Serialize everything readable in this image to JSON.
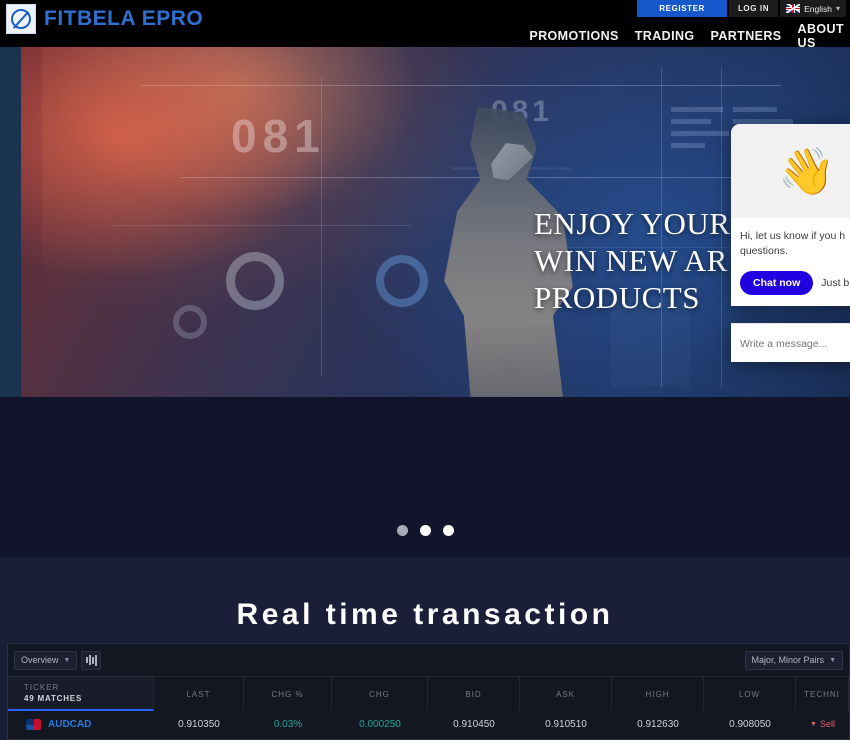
{
  "header": {
    "brand": "FITBELA EPRO",
    "logo_icon": "circle-slash-logo-icon",
    "register_label": "REGISTER",
    "login_label": "LOG IN",
    "language_label": "English",
    "language_flag_icon": "uk-flag-icon",
    "language_caret_icon": "chevron-down-icon",
    "nav": [
      {
        "label": "PROMOTIONS"
      },
      {
        "label": "TRADING"
      },
      {
        "label": "PARTNERS"
      },
      {
        "label": "ABOUT US"
      }
    ],
    "colors": {
      "register_bg": "#1658cc",
      "brand_text": "#2f6fd0",
      "bar_bg": "#000000"
    }
  },
  "hero": {
    "line1": "ENJOY YOUR T",
    "line2": "WIN NEW AR",
    "line3": "PRODUCTS",
    "overlay_numbers": {
      "left": "081",
      "right": "081"
    }
  },
  "chat": {
    "emoji_icon": "waving-hand-icon",
    "emoji": "👋",
    "message": "Hi, let us know if you h",
    "message_line2": "questions.",
    "chat_now_label": "Chat now",
    "just_browsing_label": "Just br",
    "input_placeholder": "Write a message...",
    "colors": {
      "chat_now_bg": "#2000e0",
      "card_bg": "#ffffff",
      "hero_bg": "#f1f1f1"
    }
  },
  "carousel": {
    "dots": [
      {
        "active": false
      },
      {
        "active": true
      },
      {
        "active": true
      }
    ]
  },
  "section": {
    "title": "Real time transaction"
  },
  "widget": {
    "view_select": "Overview",
    "view_caret_icon": "chevron-down-icon",
    "grid_icon": "bar-chart-icon",
    "pairs_select": "Major, Minor Pairs",
    "pairs_caret_icon": "chevron-down-icon",
    "columns": [
      {
        "key": "ticker",
        "label": "TICKER",
        "sub": "49 MATCHES"
      },
      {
        "key": "last",
        "label": "LAST"
      },
      {
        "key": "chgp",
        "label": "CHG %"
      },
      {
        "key": "chg",
        "label": "CHG"
      },
      {
        "key": "bid",
        "label": "BID"
      },
      {
        "key": "ask",
        "label": "ASK"
      },
      {
        "key": "high",
        "label": "HIGH"
      },
      {
        "key": "low",
        "label": "LOW"
      },
      {
        "key": "tech",
        "label": "TECHNI"
      }
    ],
    "rows": [
      {
        "symbol": "AUDCAD",
        "flag_icon": "audcad-flag-icon",
        "last": "0.910350",
        "chg_percent": "0.03%",
        "chg": "0.000250",
        "bid": "0.910450",
        "ask": "0.910510",
        "high": "0.912630",
        "low": "0.908050",
        "technical": "Sell",
        "technical_arrow": "▼"
      }
    ],
    "colors": {
      "positive": "#26a69a",
      "negative": "#f05c6e",
      "accent": "#2962ff",
      "bg": "#131722"
    }
  }
}
